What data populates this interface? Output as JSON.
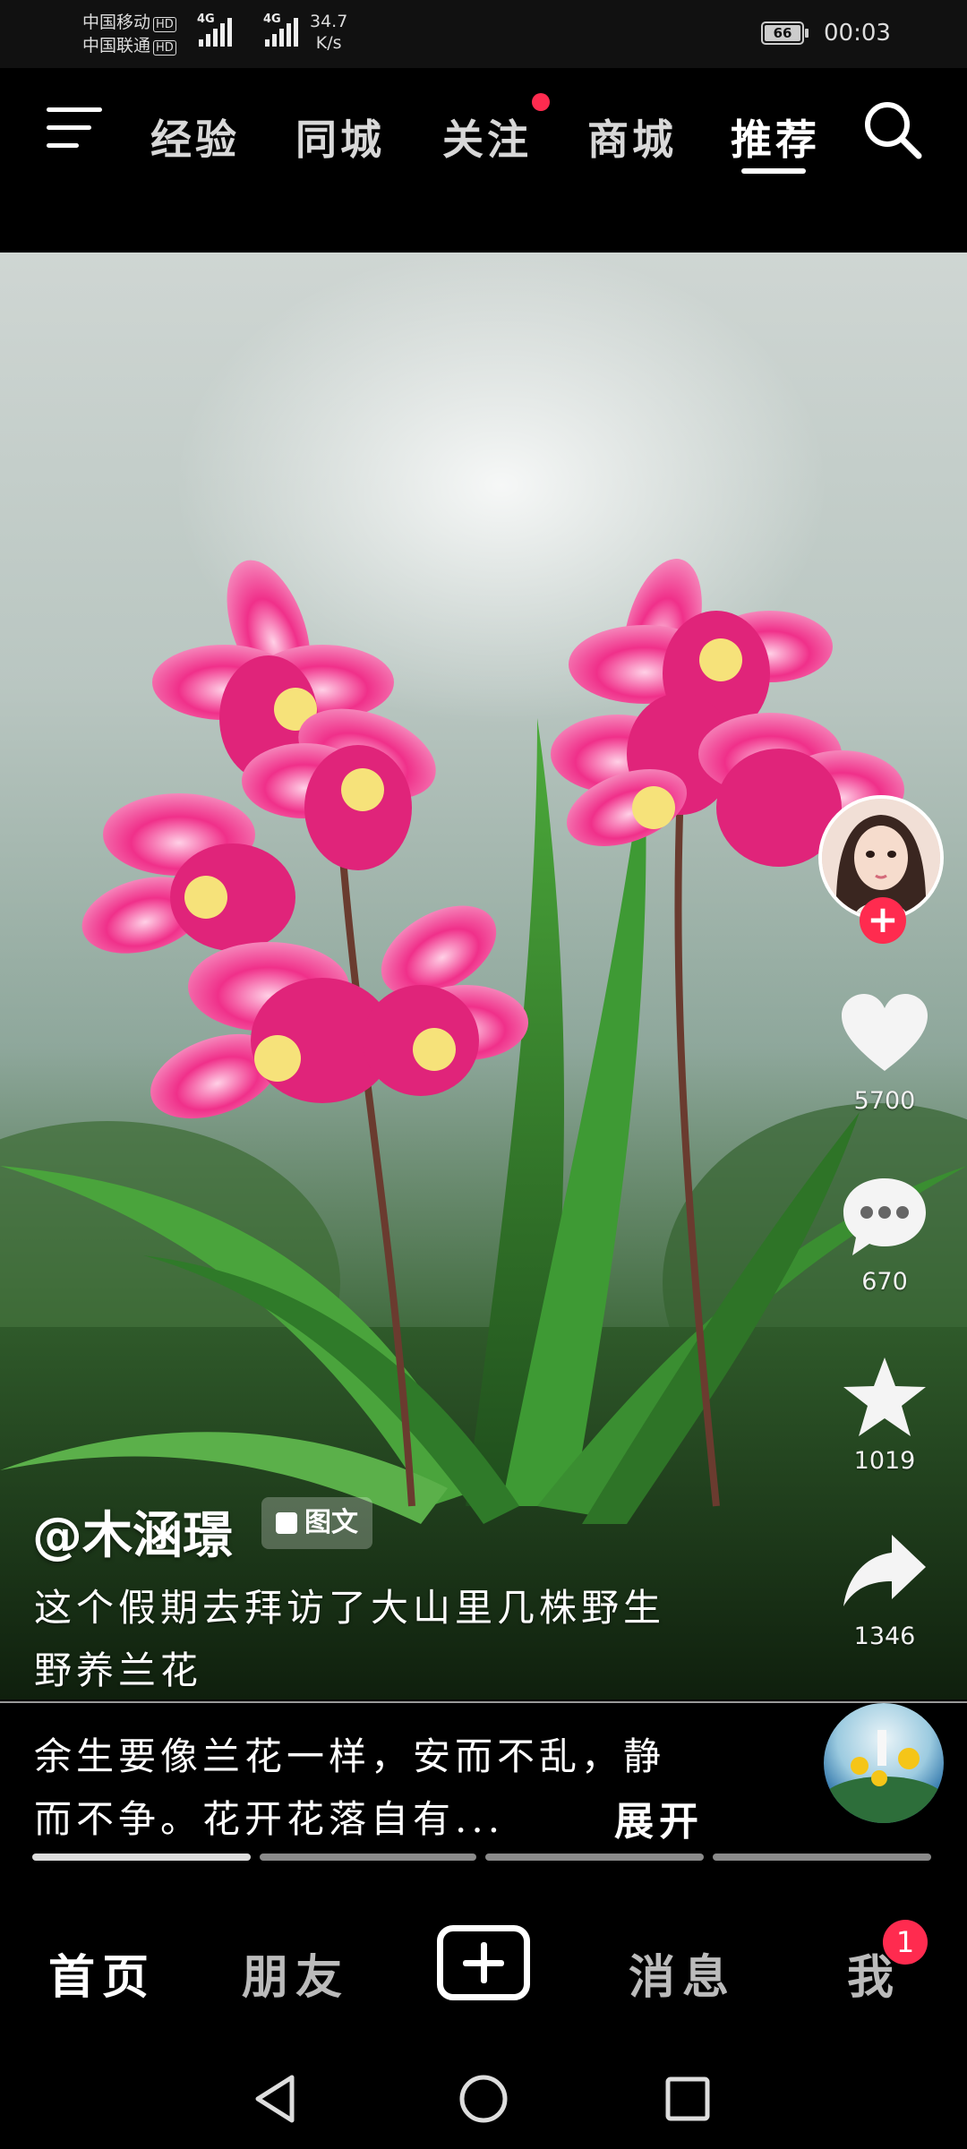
{
  "status_bar": {
    "carrier_1": "中国移动",
    "carrier_2": "中国联通",
    "hd": "HD",
    "network": "4G",
    "speed_value": "34.7",
    "speed_unit": "K/s",
    "battery": "66",
    "time": "00:03"
  },
  "top_nav": {
    "tabs": [
      {
        "label": "经验"
      },
      {
        "label": "同城"
      },
      {
        "label": "关注"
      },
      {
        "label": "商城"
      },
      {
        "label": "推荐"
      }
    ],
    "active_tab": "推荐",
    "follow_has_dot": true
  },
  "post": {
    "username": "@木涵璟",
    "type_tag": "图文",
    "caption_lines": [
      "这个假期去拜访了大山里几株野生",
      "野养兰花",
      "余生要像兰花一样，安而不乱，静",
      "而不争。花开花落自有..."
    ],
    "expand_label": "展开",
    "image_count": 4,
    "current_image": 1
  },
  "actions": {
    "likes": "5700",
    "comments": "670",
    "favorites": "1019",
    "shares": "1346"
  },
  "bottom_nav": {
    "home": "首页",
    "friends": "朋友",
    "messages": "消息",
    "me": "我",
    "me_badge": "1"
  },
  "colors": {
    "accent_red": "#ff2b4f",
    "background": "#000000",
    "text": "#ffffff"
  },
  "icons": [
    "menu-icon",
    "search-icon",
    "heart-icon",
    "comment-icon",
    "star-icon",
    "share-icon",
    "plus-icon",
    "back-icon",
    "home-circle-icon",
    "recents-icon"
  ]
}
